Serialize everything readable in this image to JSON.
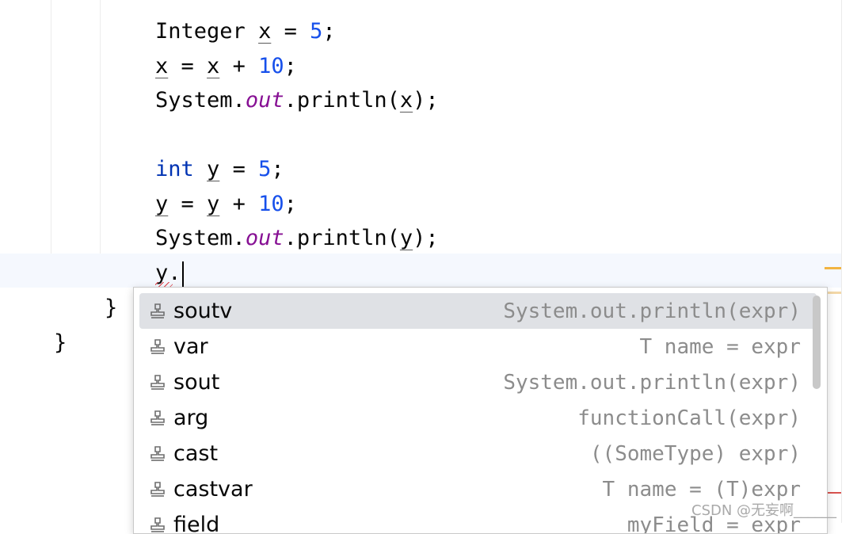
{
  "code": {
    "line1": {
      "type": "Integer",
      "var": "x",
      "op": " = ",
      "num": "5",
      "end": ";"
    },
    "line2": {
      "lhs": "x",
      "op": " = ",
      "rhs": "x",
      "plus": " + ",
      "num": "10",
      "end": ";"
    },
    "line3": {
      "cls": "System",
      "dot": ".",
      "field": "out",
      "call": ".println(",
      "arg": "x",
      "end": ");"
    },
    "line4": {
      "type": "int",
      "var": "y",
      "op": " = ",
      "num": "5",
      "end": ";"
    },
    "line5": {
      "lhs": "y",
      "op": " = ",
      "rhs": "y",
      "plus": " + ",
      "num": "10",
      "end": ";"
    },
    "line6": {
      "cls": "System",
      "dot": ".",
      "field": "out",
      "call": ".println(",
      "arg": "y",
      "end": ");"
    },
    "line7": {
      "text": "y."
    },
    "close_method": "}",
    "close_class": "}"
  },
  "completion": {
    "items": [
      {
        "name": "soutv",
        "desc": "System.out.println(expr)",
        "selected": true,
        "icon": "template-icon"
      },
      {
        "name": "var",
        "desc": "T name = expr",
        "icon": "template-icon"
      },
      {
        "name": "sout",
        "desc": "System.out.println(expr)",
        "icon": "template-icon"
      },
      {
        "name": "arg",
        "desc": "functionCall(expr)",
        "icon": "template-icon"
      },
      {
        "name": "cast",
        "desc": "((SomeType) expr)",
        "icon": "template-icon"
      },
      {
        "name": "castvar",
        "desc": "T name = (T)expr",
        "icon": "template-icon"
      },
      {
        "name": "field",
        "desc": "myField = expr",
        "icon": "template-icon"
      }
    ]
  },
  "watermark": "CSDN @无妄啊______",
  "colors": {
    "keyword": "#0033b3",
    "number": "#1750eb",
    "field": "#871094",
    "selection": "#dfe1e5",
    "hint": "#8c8c8c"
  }
}
